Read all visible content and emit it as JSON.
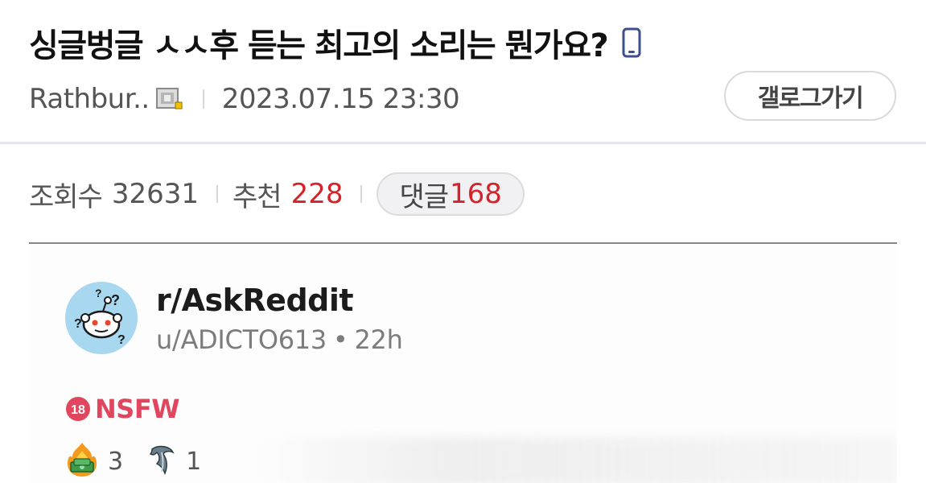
{
  "post": {
    "title": "싱글벙글 ㅅㅅ후 듣는 최고의 소리는 뭔가요?",
    "author": "Rathbur..",
    "date": "2023.07.15 23:30",
    "gallery_button": "갤로그가기",
    "icons": {
      "mobile": "mobile-phone-icon",
      "level": "user-level-icon"
    }
  },
  "stats": {
    "views_label": "조회수",
    "views": "32631",
    "recommend_label": "추천",
    "recommend": "228",
    "comments_label": "댓글",
    "comments": "168",
    "accent_color": "#d2232a"
  },
  "embed": {
    "subreddit": "r/AskReddit",
    "user": "u/ADICTO613",
    "separator": "•",
    "time": "22h",
    "nsfw_badge": "18",
    "nsfw_label": "NSFW",
    "nsfw_color": "#e0465e",
    "awards": [
      {
        "icon": "money-fire-award-icon",
        "count": "3"
      },
      {
        "icon": "dolphin-award-icon",
        "count": "1"
      }
    ]
  }
}
